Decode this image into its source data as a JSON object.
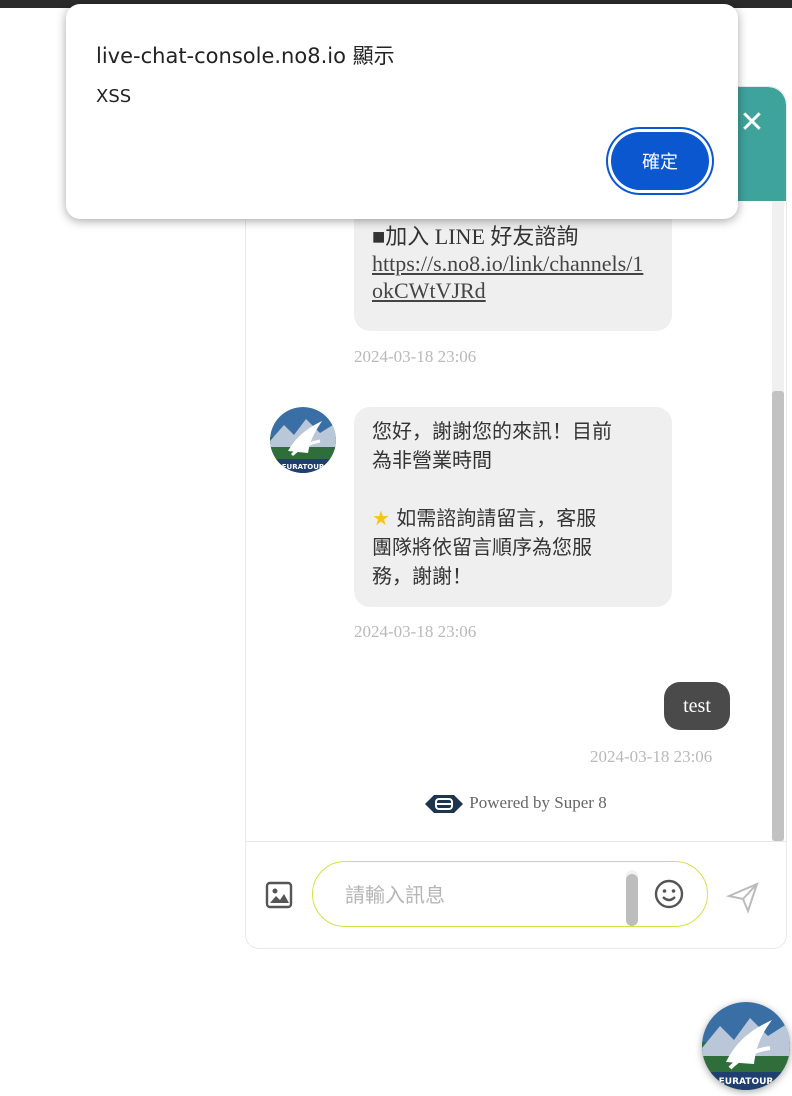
{
  "dialog": {
    "title": "live-chat-console.no8.io 顯示",
    "message": "XSS",
    "ok_label": "確定"
  },
  "chat": {
    "close_icon": "close-icon",
    "messages": [
      {
        "type": "bot",
        "text_line": "■加入 LINE 好友諮詢",
        "link_line1": "https://s.no8.io/link/channels/1",
        "link_line2": "okCWtVJRd",
        "time": "2024-03-18 23:06"
      },
      {
        "type": "bot",
        "line1": "您好，謝謝您的來訊！目前",
        "line2": "為非營業時間",
        "star_icon": "star-icon",
        "line3": "如需諮詢請留言，客服",
        "line4": "團隊將依留言順序為您服",
        "line5": "務，謝謝！",
        "time": "2024-03-18 23:06"
      },
      {
        "type": "user",
        "text": "test",
        "time": "2024-03-18 23:06"
      }
    ],
    "avatar_brand": "EURATOUR",
    "powered_by": "Powered by Super 8",
    "input_placeholder": "請輸入訊息"
  },
  "colors": {
    "header": "#3ea39b",
    "dialog_button": "#0b57d0",
    "user_bubble": "#4a4a4a",
    "bot_bubble": "#efefef",
    "input_border": "#d4e24a"
  }
}
